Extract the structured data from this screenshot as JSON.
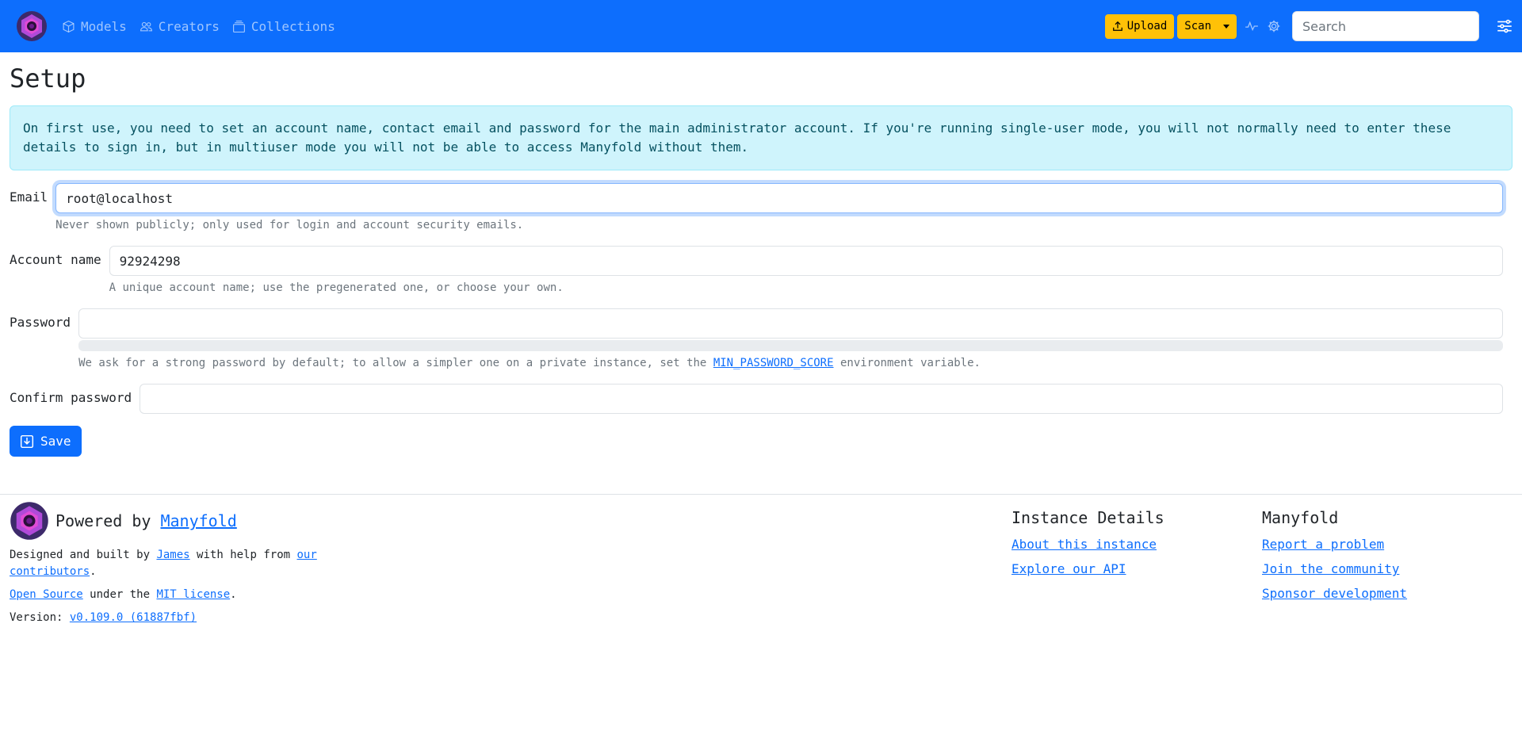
{
  "nav": {
    "links": [
      {
        "label": "Models",
        "icon": "box-icon"
      },
      {
        "label": "Creators",
        "icon": "people-icon"
      },
      {
        "label": "Collections",
        "icon": "collection-icon"
      }
    ],
    "upload_label": "Upload",
    "scan_label": "Scan",
    "search_placeholder": "Search"
  },
  "page": {
    "title": "Setup",
    "alert": "On first use, you need to set an account name, contact email and password for the main administrator account. If you're running single-user mode, you will not normally need to enter these details to sign in, but in multiuser mode you will not be able to access Manyfold without them."
  },
  "form": {
    "email": {
      "label": "Email",
      "value": "root@localhost",
      "help": "Never shown publicly; only used for login and account security emails."
    },
    "account": {
      "label": "Account name",
      "value": "92924298",
      "help": "A unique account name; use the pregenerated one, or choose your own."
    },
    "password": {
      "label": "Password",
      "value": "",
      "strength": 0,
      "help_before": "We ask for a strong password by default; to allow a simpler one on a private instance, set the",
      "help_link": "MIN_PASSWORD_SCORE",
      "help_after": "environment variable."
    },
    "confirm": {
      "label": "Confirm password",
      "value": ""
    },
    "save_label": "Save"
  },
  "footer": {
    "powered_by": "Powered by",
    "manyfold_link": "Manyfold",
    "designed_by": "Designed and built by",
    "james": "James",
    "with_help": "with help from",
    "contributors": "our contributors",
    "period": ".",
    "open_source": "Open Source",
    "under_the": "under the",
    "mit": "MIT license",
    "version_label": "Version:",
    "version": "v0.109.0 (61887fbf)",
    "instance_heading": "Instance Details",
    "instance_links": [
      "About this instance",
      "Explore our API"
    ],
    "manyfold_heading": "Manyfold",
    "manyfold_links": [
      "Report a problem",
      "Join the community",
      "Sponsor development"
    ]
  },
  "colors": {
    "navbar": "#0d6efd",
    "warning": "#ffc107",
    "alert_bg": "#cff4fc",
    "logo_purple": "#7b2cbf"
  }
}
